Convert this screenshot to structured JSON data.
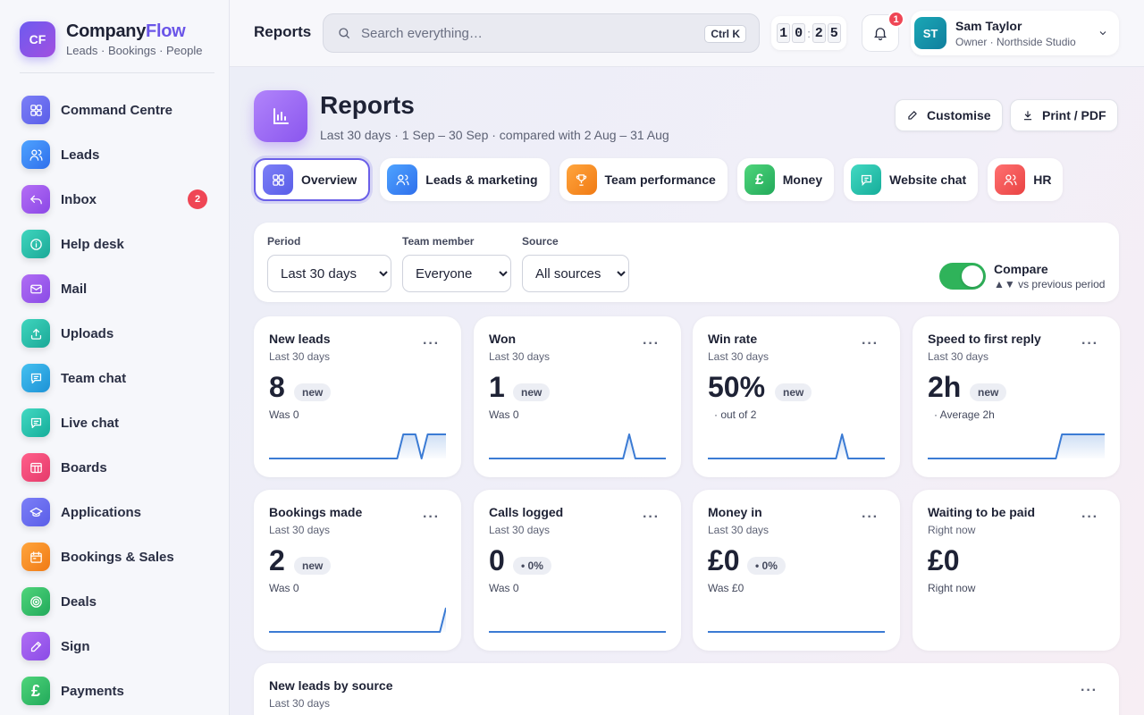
{
  "brand": {
    "logo_text": "CF",
    "name_part1": "Company",
    "name_part2": "Flow",
    "tagline": "Leads · Bookings · People",
    "accent_color": "#6a55e8"
  },
  "sidebar": {
    "items": [
      {
        "label": "Command Centre",
        "icon": "grid-icon"
      },
      {
        "label": "Leads",
        "icon": "users-icon"
      },
      {
        "label": "Inbox",
        "icon": "reply-icon",
        "badge": "2"
      },
      {
        "label": "Help desk",
        "icon": "info-icon"
      },
      {
        "label": "Mail",
        "icon": "mail-icon"
      },
      {
        "label": "Uploads",
        "icon": "upload-icon"
      },
      {
        "label": "Team chat",
        "icon": "chat-icon"
      },
      {
        "label": "Live chat",
        "icon": "chat-icon"
      },
      {
        "label": "Boards",
        "icon": "board-icon"
      },
      {
        "label": "Applications",
        "icon": "graduation-icon"
      },
      {
        "label": "Bookings & Sales",
        "icon": "calendar-icon"
      },
      {
        "label": "Deals",
        "icon": "target-icon"
      },
      {
        "label": "Sign",
        "icon": "pen-icon"
      },
      {
        "label": "Payments",
        "icon": "pound-icon"
      }
    ]
  },
  "topbar": {
    "title": "Reports",
    "search_placeholder": "Search everything…",
    "search_shortcut": "Ctrl K",
    "clock": [
      "1",
      "0",
      "2",
      "5"
    ],
    "notifications_count": "1",
    "user": {
      "initials": "ST",
      "name": "Sam Taylor",
      "role": "Owner · Northside Studio"
    }
  },
  "page": {
    "title": "Reports",
    "subtitle": "Last 30 days · 1 Sep – 30 Sep · compared with 2 Aug – 31 Aug",
    "customise_label": "Customise",
    "print_label": "Print / PDF"
  },
  "tabs": [
    {
      "label": "Overview",
      "icon": "grid-icon",
      "active": true
    },
    {
      "label": "Leads & marketing",
      "icon": "users-icon"
    },
    {
      "label": "Team performance",
      "icon": "trophy-icon"
    },
    {
      "label": "Money",
      "icon": "pound-icon"
    },
    {
      "label": "Website chat",
      "icon": "chat-icon"
    },
    {
      "label": "HR",
      "icon": "users-icon"
    }
  ],
  "filters": {
    "period": {
      "label": "Period",
      "value": "Last 30 days"
    },
    "member": {
      "label": "Team member",
      "value": "Everyone"
    },
    "source": {
      "label": "Source",
      "value": "All sources"
    },
    "compare": {
      "title": "Compare",
      "subtitle": "▲▼ vs previous period",
      "enabled": true
    }
  },
  "cards": [
    {
      "title": "New leads",
      "period": "Last 30 days",
      "value": "8",
      "badge": "new",
      "note": "Was 0",
      "trend": [
        0,
        0,
        0,
        0,
        0,
        0,
        0,
        0,
        0,
        0,
        0,
        0,
        0,
        0,
        0,
        0,
        0,
        0,
        0,
        0,
        0,
        0,
        1,
        1,
        1,
        0,
        1,
        1,
        1,
        1
      ]
    },
    {
      "title": "Won",
      "period": "Last 30 days",
      "value": "1",
      "badge": "new",
      "note": "Was 0",
      "trend": [
        0,
        0,
        0,
        0,
        0,
        0,
        0,
        0,
        0,
        0,
        0,
        0,
        0,
        0,
        0,
        0,
        0,
        0,
        0,
        0,
        0,
        0,
        0,
        1,
        0,
        0,
        0,
        0,
        0,
        0
      ]
    },
    {
      "title": "Win rate",
      "period": "Last 30 days",
      "value": "50%",
      "badge": "new",
      "note": "· out of 2",
      "trend": [
        0,
        0,
        0,
        0,
        0,
        0,
        0,
        0,
        0,
        0,
        0,
        0,
        0,
        0,
        0,
        0,
        0,
        0,
        0,
        0,
        0,
        0,
        1,
        0,
        0,
        0,
        0,
        0,
        0,
        0
      ]
    },
    {
      "title": "Speed to first reply",
      "period": "Last 30 days",
      "value": "2h",
      "badge": "new",
      "note": "· Average 2h",
      "trend": [
        0,
        0,
        0,
        0,
        0,
        0,
        0,
        0,
        0,
        0,
        0,
        0,
        0,
        0,
        0,
        0,
        0,
        0,
        0,
        0,
        0,
        0,
        1,
        1,
        1,
        1,
        1,
        1,
        1,
        1
      ]
    },
    {
      "title": "Bookings made",
      "period": "Last 30 days",
      "value": "2",
      "badge": "new",
      "note": "Was 0",
      "trend": [
        0,
        0,
        0,
        0,
        0,
        0,
        0,
        0,
        0,
        0,
        0,
        0,
        0,
        0,
        0,
        0,
        0,
        0,
        0,
        0,
        0,
        0,
        0,
        0,
        0,
        0,
        0,
        0,
        0,
        1
      ]
    },
    {
      "title": "Calls logged",
      "period": "Last 30 days",
      "value": "0",
      "badge": "• 0%",
      "note": "Was 0",
      "trend": [
        0,
        0,
        0,
        0,
        0,
        0,
        0,
        0,
        0,
        0,
        0,
        0,
        0,
        0,
        0,
        0,
        0,
        0,
        0,
        0,
        0,
        0,
        0,
        0,
        0,
        0,
        0,
        0,
        0,
        0
      ]
    },
    {
      "title": "Money in",
      "period": "Last 30 days",
      "value": "£0",
      "badge": "• 0%",
      "note": "Was £0",
      "trend": [
        0,
        0,
        0,
        0,
        0,
        0,
        0,
        0,
        0,
        0,
        0,
        0,
        0,
        0,
        0,
        0,
        0,
        0,
        0,
        0,
        0,
        0,
        0,
        0,
        0,
        0,
        0,
        0,
        0,
        0
      ]
    },
    {
      "title": "Waiting to be paid",
      "period": "Right now",
      "value": "£0",
      "badge": "",
      "note": "Right now",
      "trend": []
    }
  ],
  "bottom_card": {
    "title": "New leads by source",
    "period": "Last 30 days"
  },
  "colors": {
    "sparkline": "#3b7bd4",
    "toggle_on": "#2fb35a",
    "badge_red": "#ef4655"
  }
}
